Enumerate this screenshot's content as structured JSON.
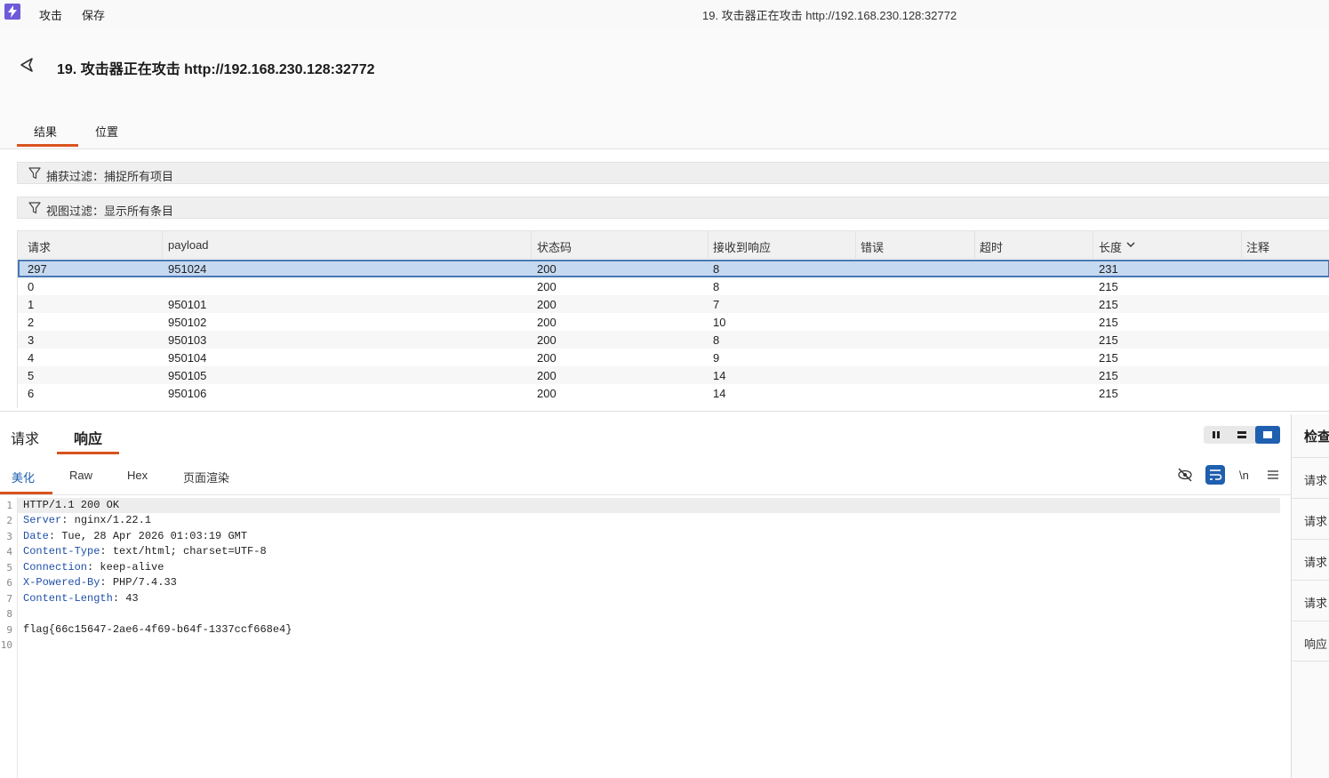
{
  "menu": {
    "items": [
      "攻击",
      "保存"
    ],
    "window_title": "19. 攻击器正在攻击 http://192.168.230.128:32772"
  },
  "header": {
    "title": "19. 攻击器正在攻击 http://192.168.230.128:32772"
  },
  "tabs": [
    "结果",
    "位置"
  ],
  "filters": {
    "capture": "捕获过滤：捕捉所有项目",
    "view": "视图过滤：显示所有条目"
  },
  "table": {
    "columns": [
      "请求",
      "payload",
      "状态码",
      "接收到响应",
      "错误",
      "超时",
      "长度",
      "注释"
    ],
    "rows": [
      [
        "297",
        "951024",
        "200",
        "8",
        "",
        "",
        "231",
        ""
      ],
      [
        "0",
        "",
        "200",
        "8",
        "",
        "",
        "215",
        ""
      ],
      [
        "1",
        "950101",
        "200",
        "7",
        "",
        "",
        "215",
        ""
      ],
      [
        "2",
        "950102",
        "200",
        "10",
        "",
        "",
        "215",
        ""
      ],
      [
        "3",
        "950103",
        "200",
        "8",
        "",
        "",
        "215",
        ""
      ],
      [
        "4",
        "950104",
        "200",
        "9",
        "",
        "",
        "215",
        ""
      ],
      [
        "5",
        "950105",
        "200",
        "14",
        "",
        "",
        "215",
        ""
      ],
      [
        "6",
        "950106",
        "200",
        "14",
        "",
        "",
        "215",
        ""
      ]
    ]
  },
  "panel": {
    "tabs": [
      "请求",
      "响应"
    ],
    "subtabs": [
      "美化",
      "Raw",
      "Hex",
      "页面渲染"
    ],
    "newline_label": "\\n"
  },
  "response": {
    "line_numbers": [
      "1",
      "2",
      "3",
      "4",
      "5",
      "6",
      "7",
      "8",
      "9",
      "10"
    ],
    "status_line": "HTTP/1.1 200 OK",
    "headers": [
      {
        "key": "Server",
        "value": "nginx/1.22.1"
      },
      {
        "key": "Date",
        "value": "Tue, 28 Apr 2026 01:03:19 GMT"
      },
      {
        "key": "Content-Type",
        "value": "text/html; charset=UTF-8"
      },
      {
        "key": "Connection",
        "value": "keep-alive"
      },
      {
        "key": "X-Powered-By",
        "value": "PHP/7.4.33"
      },
      {
        "key": "Content-Length",
        "value": "43"
      }
    ],
    "body": "flag{66c15647-2ae6-4f69-b64f-1337ccf668e4}"
  },
  "inspector": {
    "title": "检查",
    "items": [
      "请求",
      "请求",
      "请求",
      "请求",
      "响应"
    ]
  },
  "icons": [
    "app-logo-icon",
    "back-icon",
    "filter-icon",
    "sort-chevron-icon",
    "hide-icon",
    "wrap-icon",
    "menu-icon"
  ],
  "colors": {
    "accent": "#d9531e",
    "selection": "#c5d9f1",
    "link_blue": "#1f5fb0",
    "header_key": "#1f4fa8"
  }
}
